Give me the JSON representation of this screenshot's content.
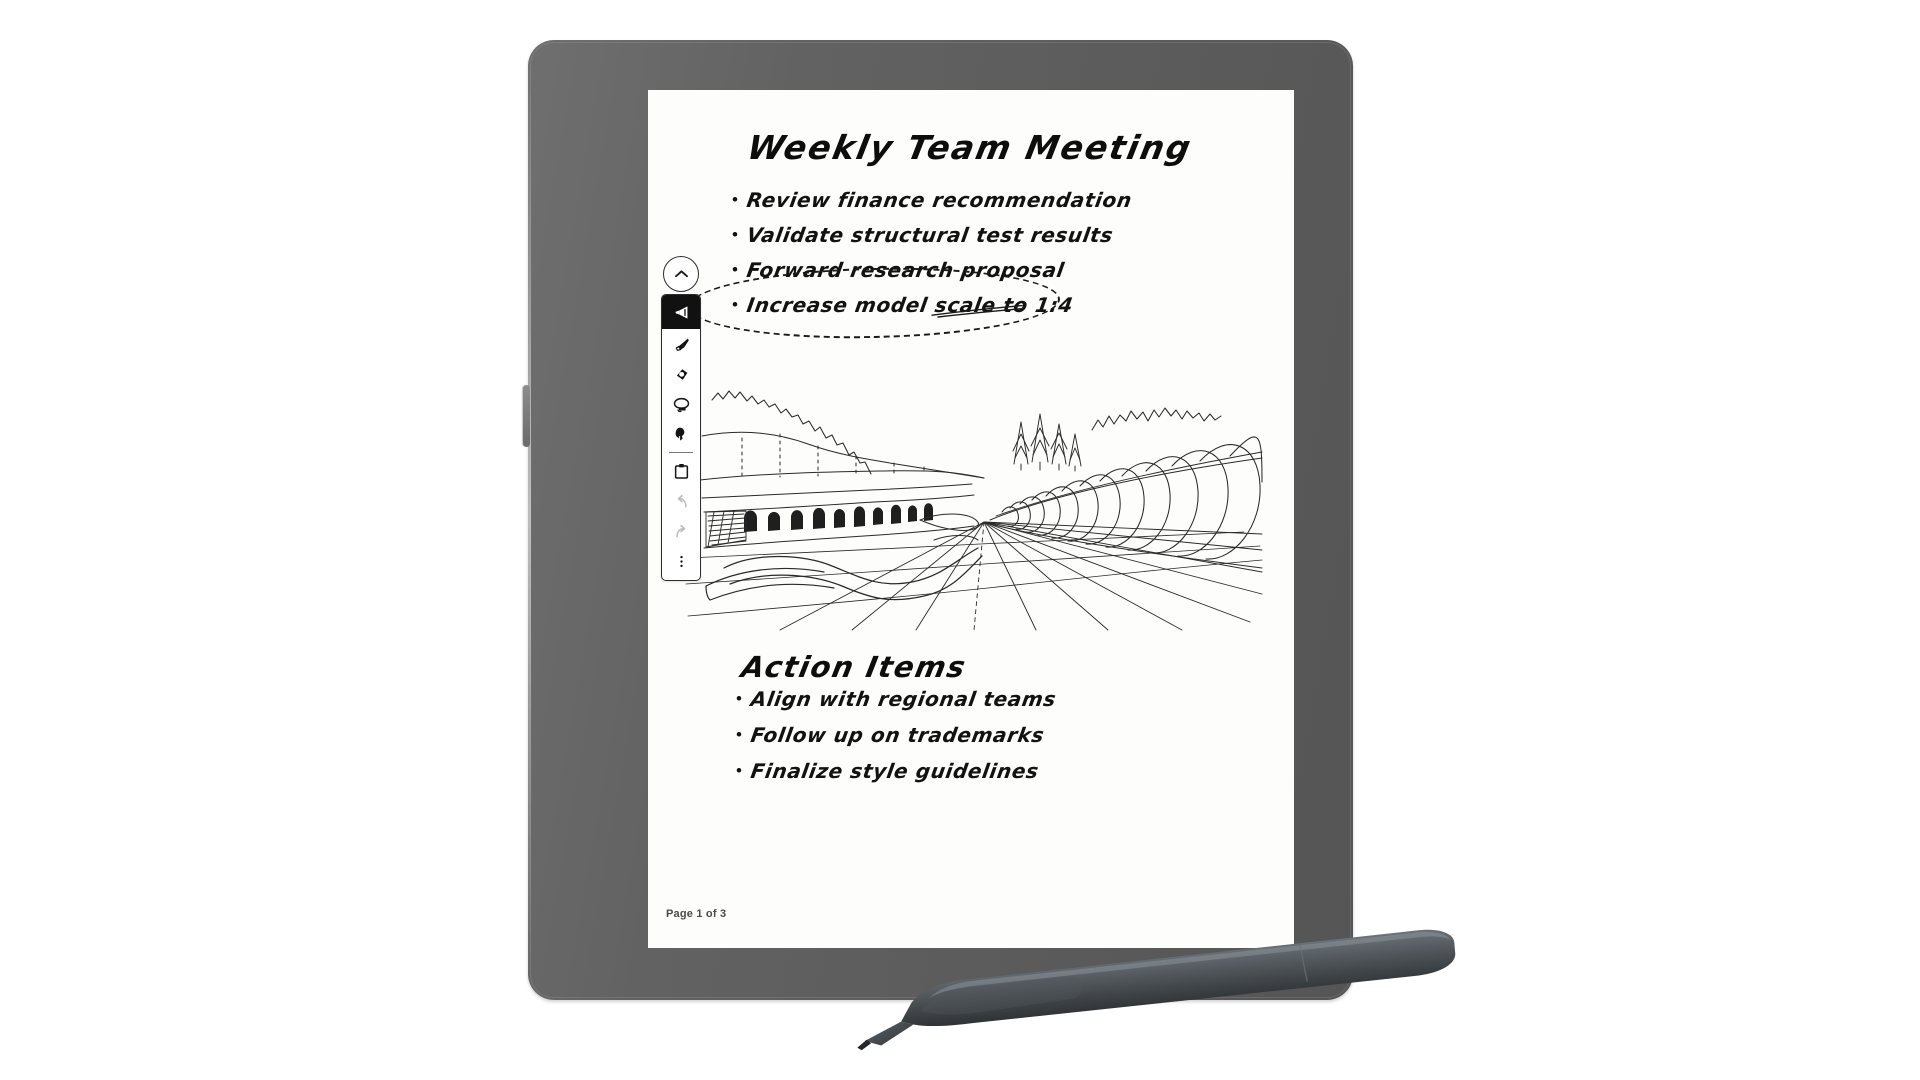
{
  "device": {
    "name": "e-ink-writing-tablet",
    "bezel_color": "#5f5f5f",
    "screen_color": "#fdfdfb",
    "power_button_label": "Power"
  },
  "toolbar": {
    "collapse_icon": "chevron-up-icon",
    "items": [
      {
        "id": "pen",
        "icon": "pen-icon",
        "label": "Pen",
        "selected": true,
        "disabled": false
      },
      {
        "id": "highlighter",
        "icon": "highlighter-icon",
        "label": "Highlighter",
        "selected": false,
        "disabled": false
      },
      {
        "id": "eraser",
        "icon": "eraser-icon",
        "label": "Eraser",
        "selected": false,
        "disabled": false
      },
      {
        "id": "lasso",
        "icon": "lasso-select-icon",
        "label": "Lasso select",
        "selected": false,
        "disabled": false
      },
      {
        "id": "pointer",
        "icon": "pointer-icon",
        "label": "Pointer",
        "selected": false,
        "disabled": false
      },
      {
        "id": "clipboard",
        "icon": "clipboard-icon",
        "label": "Clipboard",
        "selected": false,
        "disabled": false
      },
      {
        "id": "undo",
        "icon": "undo-icon",
        "label": "Undo",
        "selected": false,
        "disabled": true
      },
      {
        "id": "redo",
        "icon": "redo-icon",
        "label": "Redo",
        "selected": false,
        "disabled": true
      },
      {
        "id": "more",
        "icon": "more-options-icon",
        "label": "More options",
        "selected": false,
        "disabled": false
      }
    ]
  },
  "note": {
    "title": "Weekly Team Meeting",
    "bullets": [
      "Review  finance  recommendation",
      "Validate  structural  test  results",
      "Forward  research  proposal",
      "Increase  model  scale  to 1:4"
    ],
    "annotation": {
      "type": "dashed-ellipse-circle",
      "target_bullet_index": 3,
      "underline": "double-underline",
      "ink_color": "#1a1a1a"
    },
    "sketch": {
      "name": "perspective-landscape-sketch",
      "description": "One-point perspective landscape: mountain ridges, conifer trees, arcaded viaduct, winding river and terraced wave field"
    },
    "section_title": "Action Items",
    "action_items": [
      "Align  with  regional  teams",
      "Follow  up  on  trademarks",
      "Finalize  style  guidelines"
    ],
    "footer": "Page 1 of 3"
  },
  "accessory": {
    "stylus_label": "Stylus pen",
    "stylus_color": "#4e5458"
  }
}
